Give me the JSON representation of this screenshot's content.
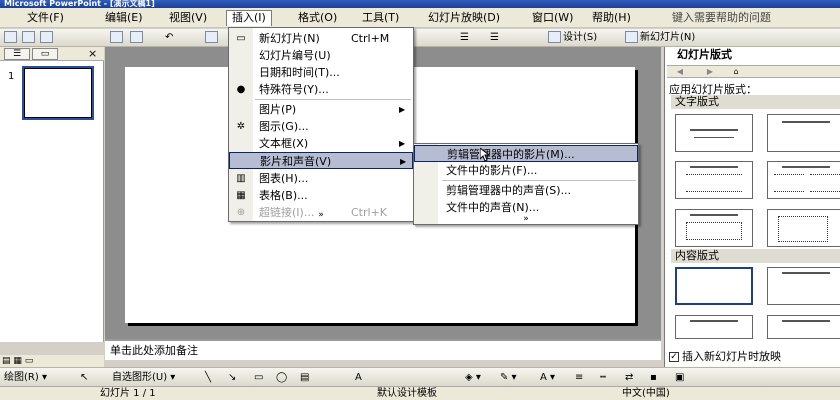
{
  "window": {
    "title": "Microsoft PowerPoint - [演示文稿1]"
  },
  "menubar": {
    "items": [
      "文件(F)",
      "编辑(E)",
      "视图(V)",
      "插入(I)",
      "格式(O)",
      "工具(T)",
      "幻灯片放映(D)",
      "窗口(W)",
      "帮助(H)"
    ],
    "help_placeholder": "键入需要帮助的问题"
  },
  "toolbar": {
    "design_label": "设计(S)",
    "new_slide_label": "新幻灯片(N)"
  },
  "insert_menu": {
    "items": [
      {
        "label": "新幻灯片(N)",
        "shortcut": "Ctrl+M"
      },
      {
        "label": "幻灯片编号(U)"
      },
      {
        "label": "日期和时间(T)..."
      },
      {
        "label": "特殊符号(Y)..."
      },
      {
        "label": "图片(P)"
      },
      {
        "label": "图示(G)..."
      },
      {
        "label": "文本框(X)"
      },
      {
        "label": "影片和声音(V)"
      },
      {
        "label": "图表(H)..."
      },
      {
        "label": "表格(B)..."
      },
      {
        "label": "超链接(I)...",
        "shortcut": "Ctrl+K"
      }
    ],
    "more": "»"
  },
  "movie_sound_submenu": {
    "items": [
      "剪辑管理器中的影片(M)...",
      "文件中的影片(F)...",
      "剪辑管理器中的声音(S)...",
      "文件中的声音(N)..."
    ],
    "more": "»"
  },
  "outline_pane": {
    "slide_number": "1",
    "close": "×"
  },
  "notes": {
    "placeholder": "单击此处添加备注"
  },
  "task_pane": {
    "title": "幻灯片版式",
    "apply_label": "应用幻灯片版式：",
    "section_text": "文字版式",
    "section_content": "内容版式",
    "checkbox_label": "插入新幻灯片时放映",
    "checkbox_checked": true
  },
  "draw_toolbar": {
    "draw_label": "绘图(R)",
    "autoshapes_label": "自选图形(U)"
  },
  "status": {
    "slide_info": "幻灯片 1 / 1",
    "template": "默认设计模板",
    "language": "中文(中国)"
  }
}
